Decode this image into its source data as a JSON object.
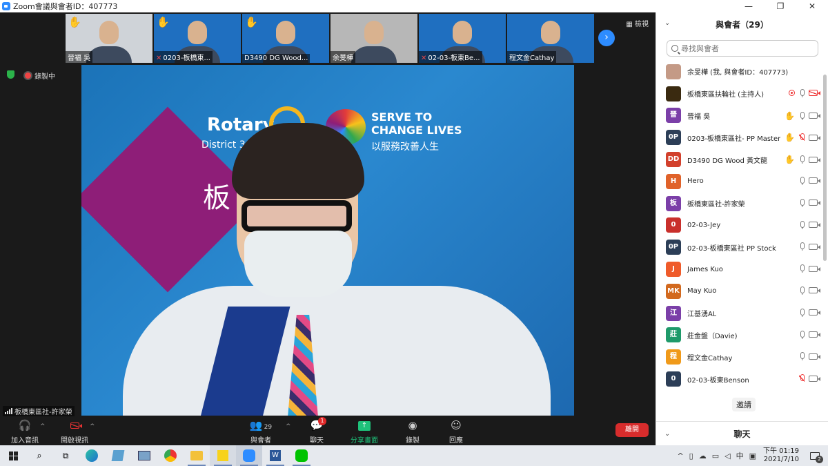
{
  "window": {
    "title": "Zoom會議與會者ID：407773",
    "minimize": "—",
    "maximize": "❐",
    "close": "✕"
  },
  "meeting": {
    "view_label": "檢視",
    "recording_label": "錄製中",
    "active_speaker_label": "板橋東區社-許家榮",
    "thumbnails": [
      {
        "name": "晉福 吳",
        "hand": true,
        "muted": false,
        "bg": "#cfd3d8"
      },
      {
        "name": "0203-板橋東...",
        "hand": true,
        "muted": true,
        "bg": "#1f6fc0"
      },
      {
        "name": "D3490 DG  Wood...",
        "hand": true,
        "muted": false,
        "bg": "#1f6fc0"
      },
      {
        "name": "余旻樺",
        "hand": false,
        "muted": false,
        "bg": "#b7b7b7"
      },
      {
        "name": "02-03-板東Be...",
        "hand": false,
        "muted": true,
        "bg": "#1f6fc0"
      },
      {
        "name": "程文金Cathay",
        "hand": false,
        "muted": false,
        "bg": "#1f6fc0"
      }
    ],
    "next_arrow": "›",
    "video": {
      "brand": "Rotary",
      "district": "District 34",
      "slogan_line1": "SERVE TO",
      "slogan_line2": "CHANGE LIVES",
      "slogan_zh": "以服務改善人生",
      "club_name": "板                扶輪社"
    }
  },
  "toolbar": {
    "audio": "加入音訊",
    "video": "開啟視訊",
    "participants": "與會者",
    "participants_count": "29",
    "chat": "聊天",
    "chat_badge": "1",
    "share": "分享畫面",
    "record": "錄製",
    "reactions": "回應",
    "leave": "離開"
  },
  "panel": {
    "title": "與會者（29）",
    "search_placeholder": "尋找與會者",
    "invite": "邀請",
    "chat_header": "聊天",
    "participants": [
      {
        "initials": "",
        "name": "余旻樺 (我, 與會者ID：407773)",
        "color": "#c49a86",
        "hand": false,
        "rec": false,
        "mic": "none",
        "cam": "none"
      },
      {
        "initials": "",
        "name": "板橋東區扶輪社 (主持人)",
        "color": "#3a2a10",
        "hand": false,
        "rec": true,
        "mic": "on",
        "cam": "off"
      },
      {
        "initials": "晉",
        "name": "晉福 吳",
        "color": "#7b3fa8",
        "hand": true,
        "rec": false,
        "mic": "on",
        "cam": "on"
      },
      {
        "initials": "0P",
        "name": "0203-板橋東區社- PP Master",
        "color": "#2c3e57",
        "hand": true,
        "rec": false,
        "mic": "off",
        "cam": "on"
      },
      {
        "initials": "DD",
        "name": "D3490 DG  Wood 黃文龍",
        "color": "#d2402c",
        "hand": true,
        "rec": false,
        "mic": "on",
        "cam": "on"
      },
      {
        "initials": "H",
        "name": "Hero",
        "color": "#e0622a",
        "hand": false,
        "rec": false,
        "mic": "on",
        "cam": "on"
      },
      {
        "initials": "板",
        "name": "板橋東區社-許家榮",
        "color": "#7b3fa8",
        "hand": false,
        "rec": false,
        "mic": "on",
        "cam": "on"
      },
      {
        "initials": "0",
        "name": "02-03-Jey",
        "color": "#c9302c",
        "hand": false,
        "rec": false,
        "mic": "on",
        "cam": "on"
      },
      {
        "initials": "0P",
        "name": "02-03-板橋東區社 PP Stock",
        "color": "#2c3e57",
        "hand": false,
        "rec": false,
        "mic": "on",
        "cam": "on"
      },
      {
        "initials": "J",
        "name": "James Kuo",
        "color": "#ef5b2a",
        "hand": false,
        "rec": false,
        "mic": "on",
        "cam": "on"
      },
      {
        "initials": "MK",
        "name": "May Kuo",
        "color": "#d2691e",
        "hand": false,
        "rec": false,
        "mic": "on",
        "cam": "on"
      },
      {
        "initials": "江",
        "name": "江基湧AL",
        "color": "#7b3fa8",
        "hand": false,
        "rec": false,
        "mic": "on",
        "cam": "on"
      },
      {
        "initials": "莊",
        "name": "莊金盤（Davie)",
        "color": "#1f9a6a",
        "hand": false,
        "rec": false,
        "mic": "on",
        "cam": "on"
      },
      {
        "initials": "程",
        "name": "程文金Cathay",
        "color": "#f09a1a",
        "hand": false,
        "rec": false,
        "mic": "on",
        "cam": "on"
      },
      {
        "initials": "0",
        "name": "02-03-板東Benson",
        "color": "#2c3e57",
        "hand": false,
        "rec": false,
        "mic": "off",
        "cam": "on"
      }
    ]
  },
  "taskbar": {
    "time": "下午 01:19",
    "date": "2021/7/10",
    "notifications": "2",
    "input_method": "中"
  }
}
